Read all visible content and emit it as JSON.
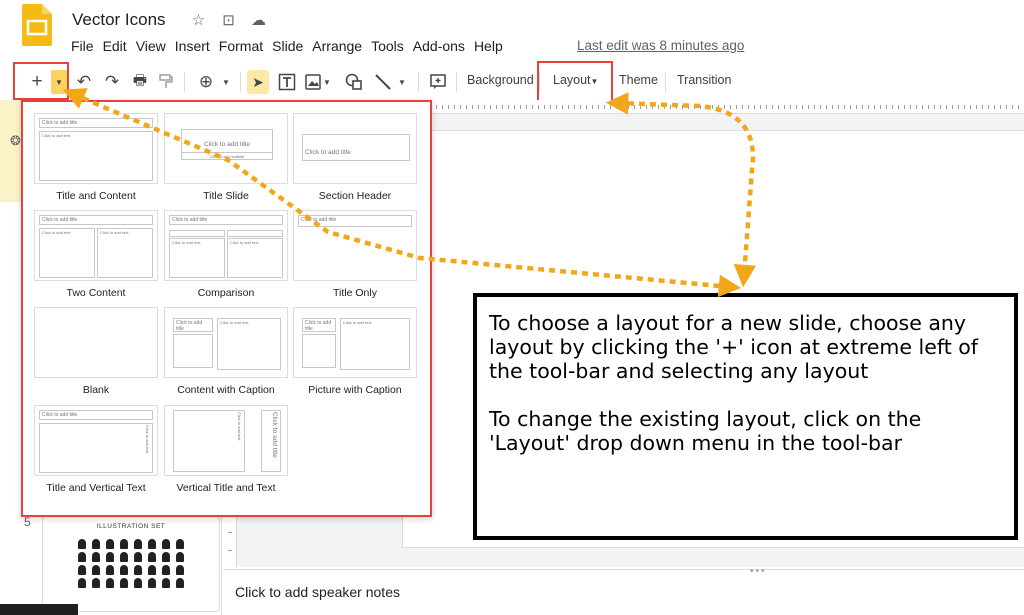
{
  "app": {
    "doc_title": "Vector Icons",
    "title_icons": [
      "star-icon",
      "move-to-folder-icon",
      "cloud-saved-icon"
    ],
    "menu": [
      "File",
      "Edit",
      "View",
      "Insert",
      "Format",
      "Slide",
      "Arrange",
      "Tools",
      "Add-ons",
      "Help"
    ],
    "last_edit": "Last edit was 8 minutes ago"
  },
  "toolbar": {
    "new_slide": "+",
    "undo": "↶",
    "redo": "↷",
    "print": "🖶",
    "zoom": "⊕",
    "select": "➤",
    "textbox": "T",
    "background_label": "Background",
    "layout_label": "Layout",
    "theme_label": "Theme",
    "transition_label": "Transition"
  },
  "layouts": [
    {
      "name": "Title and Content",
      "title_ph": "Click to add title",
      "body_ph": "Click to add text"
    },
    {
      "name": "Title Slide",
      "title_ph": "Click to add title",
      "body_ph": "Click to add subtitle"
    },
    {
      "name": "Section Header",
      "title_ph": "Click to add title"
    },
    {
      "name": "Two Content",
      "title_ph": "Click to add title",
      "body_ph": "Click to add text"
    },
    {
      "name": "Comparison",
      "title_ph": "Click to add title",
      "body_ph": "Click to add text"
    },
    {
      "name": "Title Only",
      "title_ph": "Click to add title"
    },
    {
      "name": "Blank"
    },
    {
      "name": "Content with Caption",
      "title_ph": "Click to add title",
      "body_ph": "Click to add text"
    },
    {
      "name": "Picture with Caption",
      "title_ph": "Click to add title",
      "body_ph": "Click to add text"
    },
    {
      "name": "Title and Vertical Text",
      "title_ph": "Click to add title",
      "body_ph": "Click to add text"
    },
    {
      "name": "Vertical Title and Text",
      "title_ph": "Click to add title",
      "body_ph": "Click to add text"
    }
  ],
  "filmstrip": {
    "slide_number": "5",
    "thumb_title": "ILLUSTRATION SET"
  },
  "notes": {
    "placeholder": "Click to add speaker notes"
  },
  "annotation": {
    "paragraph1": "To choose a layout for a new slide, choose any layout by clicking the '+' icon at extreme left of the tool-bar and selecting any layout",
    "paragraph2": "To change the existing layout, click on the 'Layout' drop down menu in the tool-bar"
  },
  "colors": {
    "brand_yellow": "#f5ba14",
    "highlight_red": "#e8413c",
    "arrow_orange": "#f2a71b"
  }
}
